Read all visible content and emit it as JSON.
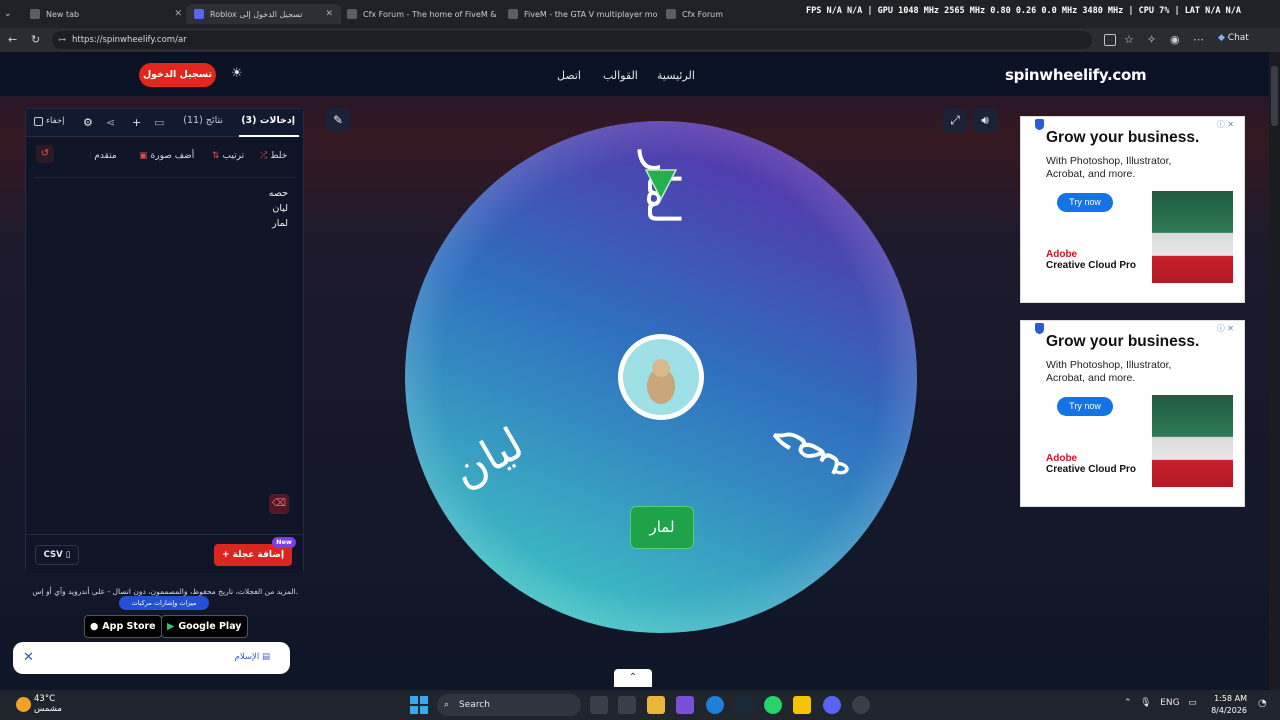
{
  "browser": {
    "tabs": [
      {
        "title": "New tab"
      },
      {
        "title": "Roblox تسجيل الدخول إلى"
      },
      {
        "title": "Cfx Forum - The home of FiveM &"
      },
      {
        "title": "FiveM - the GTA V multiplayer mo"
      },
      {
        "title": "Cfx Forum"
      }
    ],
    "overlay_stats": "FPS N/A N/A | GPU 1048 MHz 2565 MHz 0.80 0.26 0.0 MHz 3480 MHz | CPU 7% | LAT N/A N/A",
    "url": "https://spinwheelify.com/ar",
    "chat_label": "Chat"
  },
  "site": {
    "logo": "spinwheelify.com",
    "nav": [
      "الرئيسية",
      "القوالب",
      "اتصل"
    ],
    "signin": "تسجيل الدخول"
  },
  "panel": {
    "tab_entries": "إدخالات (3)",
    "tab_results": "نتائج (11)",
    "hide_label": "إخفاء",
    "tools": {
      "shuffle": "خلط",
      "sort": "ترتيب",
      "add_image": "أضف صورة",
      "advanced": "متقدم"
    },
    "entries": [
      "حصه",
      "ليان",
      "لمار"
    ],
    "csv_label": "CSV",
    "add_wheel": "إضافة عجلة",
    "new_badge": "New"
  },
  "promo": {
    "text": "المزيد من العجلات، تاريخ محفوظ، والمصممون، دون اتصال - على أندرويد وآي أو إس.",
    "badge": "ميزات وإشارات مركبات",
    "app_store": "App Store",
    "google_play": "Google Play",
    "notice_text": "الإسلام"
  },
  "wheel": {
    "segments": [
      "لمار",
      "حصه",
      "ليان"
    ],
    "winner": "لمار",
    "colors": {
      "top": "#5a2fa8",
      "mid": "#2f6fbf",
      "bottom": "#3fc6c4"
    }
  },
  "ads": [
    {
      "headline": "Grow your business.",
      "sub": "With Photoshop, Illustrator, Acrobat, and more.",
      "cta": "Try now",
      "brand": "Adobe",
      "product": "Creative Cloud Pro"
    },
    {
      "headline": "Grow your business.",
      "sub": "With Photoshop, Illustrator, Acrobat, and more.",
      "cta": "Try now",
      "brand": "Adobe",
      "product": "Creative Cloud Pro"
    }
  ],
  "taskbar": {
    "weather_temp": "43°C",
    "weather_desc": "مشمس",
    "search": "Search",
    "lang": "ENG",
    "time": "1:58 AM",
    "date": "8/4/2026"
  }
}
